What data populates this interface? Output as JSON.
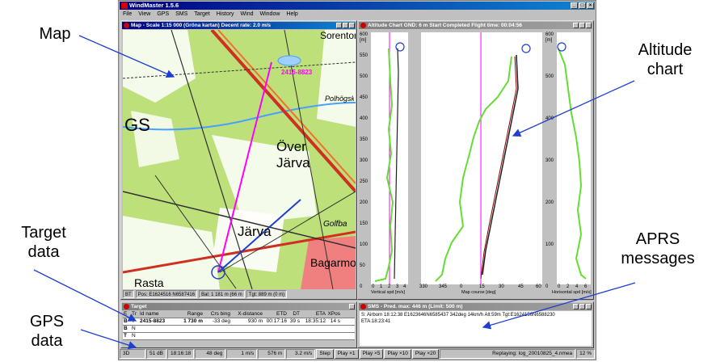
{
  "annotations": {
    "map": "Map",
    "altitude": "Altitude chart",
    "target": "Target data",
    "gps": "GPS data",
    "aprs": "APRS messages"
  },
  "app": {
    "title": "WindMaster 1.5.6",
    "menu": [
      "File",
      "View",
      "GPS",
      "SMS",
      "Target",
      "History",
      "Wind",
      "Window",
      "Help"
    ]
  },
  "map_window": {
    "title": "Map - Scale 1:15 000 (Gröna kartan) Decent rate: 2.0 m/s",
    "place_labels": [
      "Över",
      "Järva",
      "Järva",
      "Bagarmossen",
      "Rasta",
      "Sorentorp",
      "Golfba",
      "Polhögskolan",
      "GS"
    ],
    "target_label": "2415-8823",
    "status": [
      "BT",
      "Pos: E1624516 N6587416",
      "Bal: 1 181 m (66 m",
      "Tgt: 889 m (0 m)"
    ]
  },
  "altitude_window": {
    "title": "Altitude Chart   GND: 6 m Start Completed   Flight time: 00:04:56",
    "y_ticks": [
      "600",
      "550",
      "500",
      "450",
      "400",
      "350",
      "300",
      "250",
      "200",
      "150",
      "100",
      "50",
      "0"
    ],
    "y_unit": "[m]",
    "left_xlabel": "Vertical spd [m/s]",
    "left_xticks": [
      "0",
      "1",
      "2",
      "3",
      "4"
    ],
    "mid_xlabel": "Map course [deg]",
    "mid_xticks": [
      "330",
      "345",
      "0",
      "15",
      "30",
      "45",
      "60"
    ],
    "right_xlabel": "Horisontal spd [m/s]",
    "right_xticks": [
      "0",
      "2",
      "4",
      "6"
    ]
  },
  "target_window": {
    "title": "Target",
    "headers": [
      "E",
      "Tr",
      "Id name",
      "Range",
      "Crs bing",
      "X-distance",
      "ETD",
      "DT",
      "ETA",
      "XPos"
    ],
    "rows": [
      [
        "B",
        "T",
        "2415-8823",
        "1 730 m",
        "-33 deg",
        "930 m",
        "00:17:16",
        "39 s",
        "18:35:12",
        "14 s"
      ],
      [
        "B",
        "N",
        "",
        "",
        "",
        "",
        "",
        "",
        "",
        ""
      ],
      [
        "T",
        "N",
        "",
        "",
        "",
        "",
        "",
        "",
        "",
        ""
      ]
    ]
  },
  "sms_window": {
    "title": "SMS - Pred. max: 446 m (Limit: 500 m)",
    "lines": [
      "S: Airborn 18:12:38 E1623646N6585437 342deg 14km/h Alt:59m Tgt:E1624156N6588230",
      "ETA:18:23:41"
    ]
  },
  "bottom_bar": {
    "fix": "3D",
    "signal": "51 dB",
    "time": "18:16:18",
    "heading": "48 deg",
    "vspeed": "1 m/s",
    "altitude": "576 m",
    "hspeed": "3.2 m/s",
    "buttons": [
      "Step",
      "Play ×1",
      "Play ×5",
      "Play ×10",
      "Play ×20"
    ],
    "replay": "Replaying: log_20010825_4.nmea",
    "percent": "12 %"
  },
  "colors": {
    "track": "#ff00ff",
    "green_curve": "#66dd33",
    "dark_curve": "#202020",
    "marker": "#1f3fd0",
    "annotation_arrow": "#1f3fd0"
  }
}
